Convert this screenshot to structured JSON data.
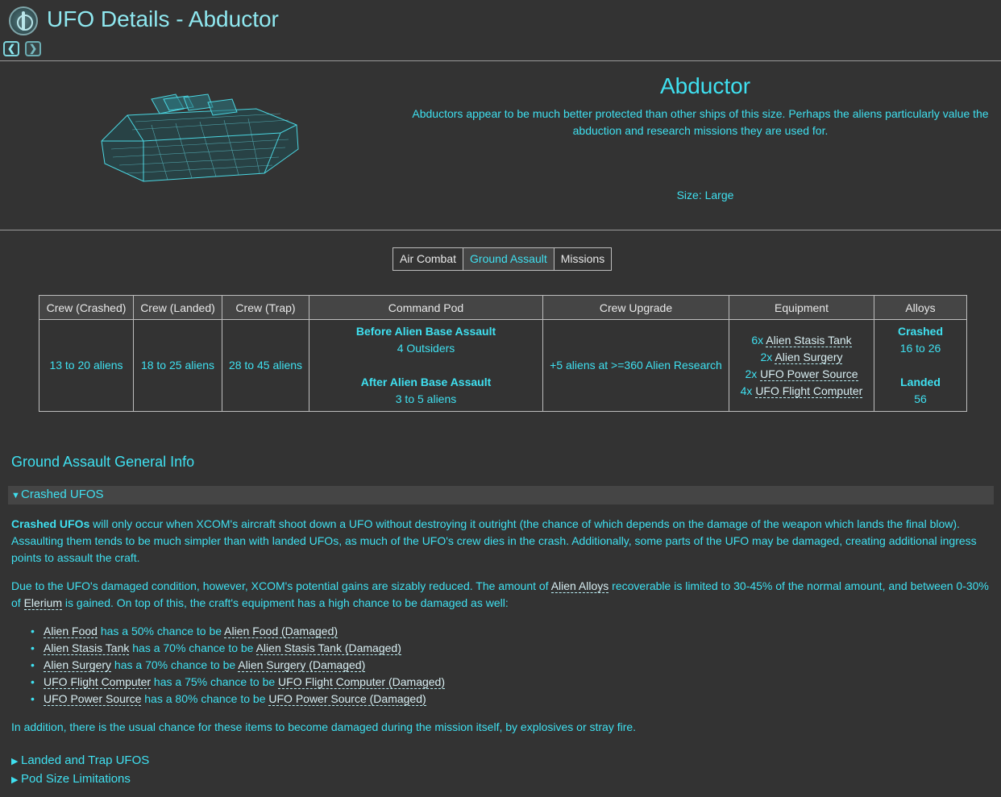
{
  "header": {
    "title": "UFO Details - Abductor",
    "prev_icon": "chevron-left-icon",
    "next_icon": "chevron-right-icon"
  },
  "hero": {
    "name": "Abductor",
    "description": "Abductors appear to be much better protected than other ships of this size. Perhaps the aliens particularly value the abduction and research missions they are used for.",
    "size": "Size: Large"
  },
  "tabs": [
    "Air Combat",
    "Ground Assault",
    "Missions"
  ],
  "active_tab": "Ground Assault",
  "table": {
    "headers": [
      "Crew (Crashed)",
      "Crew (Landed)",
      "Crew (Trap)",
      "Command Pod",
      "Crew Upgrade",
      "Equipment",
      "Alloys"
    ],
    "crew_crashed": "13 to 20 aliens",
    "crew_landed": "18 to 25 aliens",
    "crew_trap": "28 to 45 aliens",
    "command_pod": {
      "before_label": "Before Alien Base Assault",
      "before_value": "4 Outsiders",
      "after_label": "After Alien Base Assault",
      "after_value": "3 to 5 aliens"
    },
    "crew_upgrade": "+5 aliens at >=360 Alien Research",
    "equipment": [
      {
        "qty": "6x",
        "item": "Alien Stasis Tank"
      },
      {
        "qty": "2x",
        "item": "Alien Surgery"
      },
      {
        "qty": "2x",
        "item": "UFO Power Source"
      },
      {
        "qty": "4x",
        "item": "UFO Flight Computer"
      }
    ],
    "alloys": {
      "crashed_label": "Crashed",
      "crashed_value": "16 to 26",
      "landed_label": "Landed",
      "landed_value": "56"
    }
  },
  "general_info": {
    "title": "Ground Assault General Info",
    "crashed_summary": "Crashed UFOS",
    "p1_bold": "Crashed UFOs",
    "p1_rest": " will only occur when XCOM's aircraft shoot down a UFO without destroying it outright (the chance of which depends on the damage of the weapon which lands the final blow). Assaulting them tends to be much simpler than with landed UFOs, as much of the UFO's crew dies in the crash. Additionally, some parts of the UFO may be damaged, creating additional ingress points to assault the craft.",
    "p2_a": "Due to the UFO's damaged condition, however, XCOM's potential gains are sizably reduced. The amount of ",
    "p2_link1": "Alien Alloys",
    "p2_b": " recoverable is limited to 30-45% of the normal amount, and between 0-30% of ",
    "p2_link2": "Elerium",
    "p2_c": " is gained. On top of this, the craft's equipment has a high chance to be damaged as well:",
    "chances": [
      {
        "item": "Alien Food",
        "mid": " has a 50% chance to be ",
        "damaged": "Alien Food (Damaged)"
      },
      {
        "item": "Alien Stasis Tank",
        "mid": " has a 70% chance to be ",
        "damaged": "Alien Stasis Tank (Damaged)"
      },
      {
        "item": "Alien Surgery",
        "mid": " has a 70% chance to be ",
        "damaged": "Alien Surgery (Damaged)"
      },
      {
        "item": "UFO Flight Computer",
        "mid": " has a 75% chance to be ",
        "damaged": "UFO Flight Computer (Damaged)"
      },
      {
        "item": "UFO Power Source",
        "mid": " has a 80% chance to be ",
        "damaged": "UFO Power Source (Damaged)"
      }
    ],
    "p3": "In addition, there is the usual chance for these items to become damaged during the mission itself, by explosives or stray fire.",
    "landed_summary": "Landed and Trap UFOS",
    "pod_summary": "Pod Size Limitations"
  }
}
